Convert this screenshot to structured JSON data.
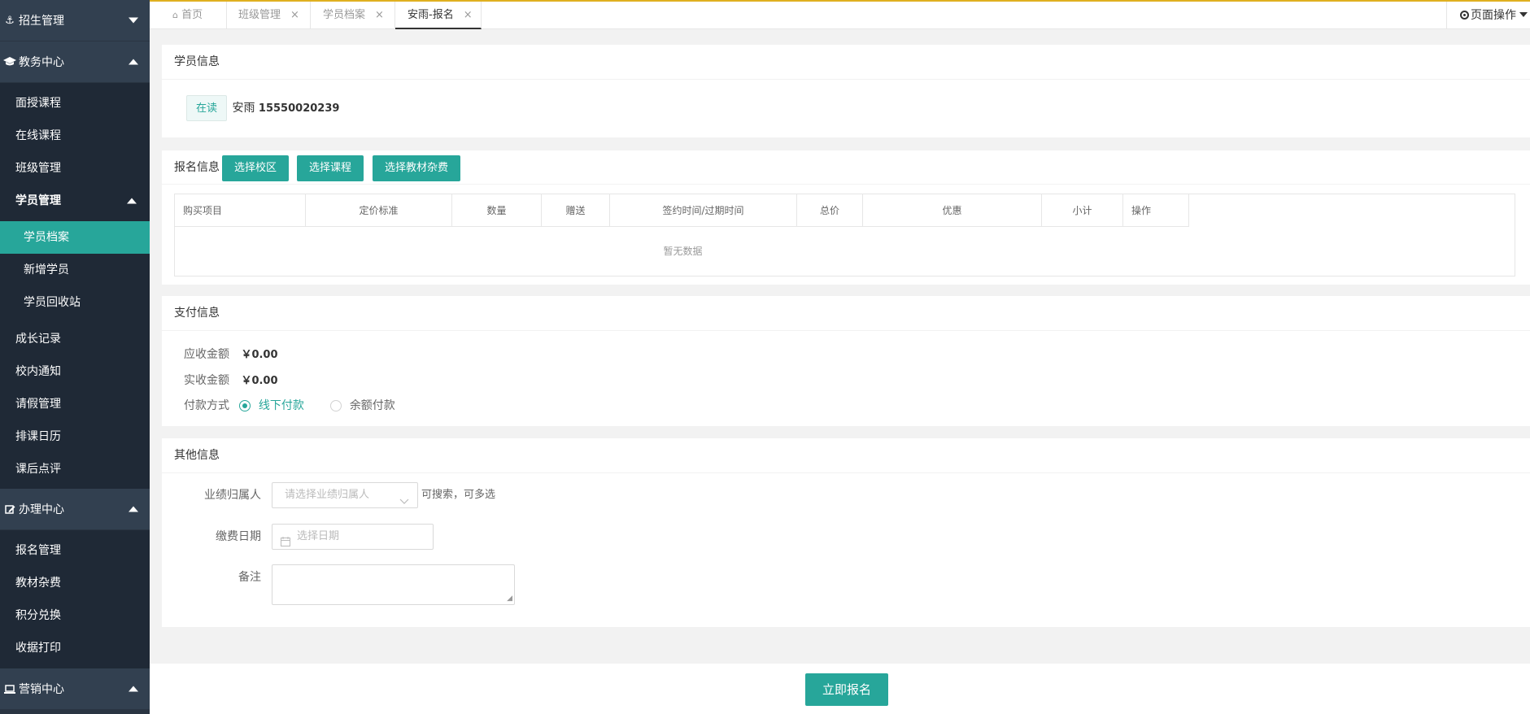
{
  "sidebar": {
    "groups": [
      {
        "label": "招生管理",
        "icon": "anchor-icon",
        "expanded": false
      },
      {
        "label": "教务中心",
        "icon": "graduation-cap-icon",
        "expanded": true
      },
      {
        "label": "办理中心",
        "icon": "edit-icon",
        "expanded": true
      },
      {
        "label": "营销中心",
        "icon": "laptop-icon",
        "expanded": true
      }
    ],
    "edu_items": [
      "面授课程",
      "在线课程",
      "班级管理"
    ],
    "student_mgmt": "学员管理",
    "student_sub": [
      "学员档案",
      "新增学员",
      "学员回收站"
    ],
    "edu_items_after": [
      "成长记录",
      "校内通知",
      "请假管理",
      "排课日历",
      "课后点评"
    ],
    "handle_items": [
      "报名管理",
      "教材杂费",
      "积分兑换",
      "收据打印"
    ]
  },
  "tabs": [
    {
      "label": "首页",
      "icon": "home-icon"
    },
    {
      "label": "班级管理"
    },
    {
      "label": "学员档案"
    },
    {
      "label": "安雨-报名",
      "active": true
    }
  ],
  "tab_close": "×",
  "page_ops": "页面操作",
  "student": {
    "title": "学员信息",
    "status": "在读",
    "name": "安雨",
    "phone": "15550020239"
  },
  "enroll": {
    "title": "报名信息",
    "buttons": [
      "选择校区",
      "选择课程",
      "选择教材杂费"
    ],
    "columns": [
      "购买项目",
      "定价标准",
      "数量",
      "赠送",
      "签约时间/过期时间",
      "总价",
      "优惠",
      "小计",
      "操作"
    ],
    "empty": "暂无数据"
  },
  "payment": {
    "title": "支付信息",
    "receivable_label": "应收金额",
    "receivable_value": "￥0.00",
    "received_label": "实收金额",
    "received_value": "￥0.00",
    "method_label": "付款方式",
    "methods": [
      {
        "label": "线下付款",
        "selected": true
      },
      {
        "label": "余额付款",
        "selected": false
      }
    ]
  },
  "other": {
    "title": "其他信息",
    "performance_label": "业绩归属人",
    "performance_placeholder": "请选择业绩归属人",
    "performance_hint": "可搜索，可多选",
    "pay_date_label": "缴费日期",
    "pay_date_placeholder": "选择日期",
    "remark_label": "备注"
  },
  "submit_label": "立即报名",
  "colors": {
    "accent": "#27a69a",
    "sidebar_bg": "#2a3542",
    "tab_top": "#e0b020"
  }
}
